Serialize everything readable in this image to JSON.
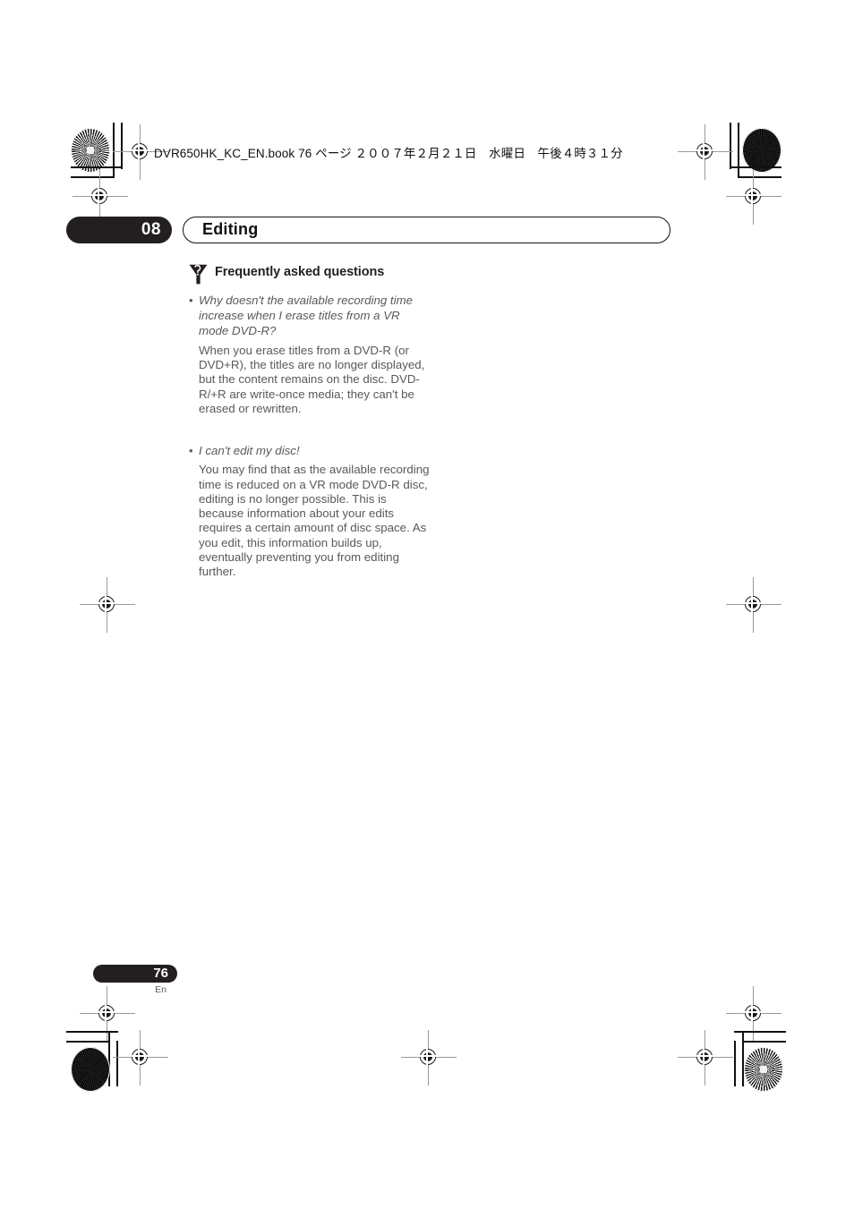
{
  "print_marks": {
    "book_line": "DVR650HK_KC_EN.book  76 ページ  ２００７年２月２１日　水曜日　午後４時３１分"
  },
  "chapter": {
    "number": "08",
    "title": "Editing"
  },
  "faq": {
    "icon": "question-funnel-icon",
    "heading": "Frequently asked questions",
    "entries": [
      {
        "bullet": "•",
        "question": "Why doesn't the available recording time increase when I erase titles from a VR mode DVD-R?",
        "answer": "When you erase titles from a DVD-R (or DVD+R), the titles are no longer displayed, but the content remains on the disc. DVD-R/+R are write-once media; they can't be erased or rewritten."
      },
      {
        "bullet": "•",
        "question": "I can't edit my disc!",
        "answer": "You may find that as the available recording time is reduced on a VR mode DVD-R disc, editing is no longer possible. This is because information about your edits requires a certain amount of disc space. As you edit, this information builds up, eventually preventing you from editing further."
      }
    ]
  },
  "footer": {
    "page_number": "76",
    "language": "En"
  },
  "colors": {
    "ink_black": "#231f20",
    "body_gray": "#58595b",
    "paper": "#ffffff"
  }
}
